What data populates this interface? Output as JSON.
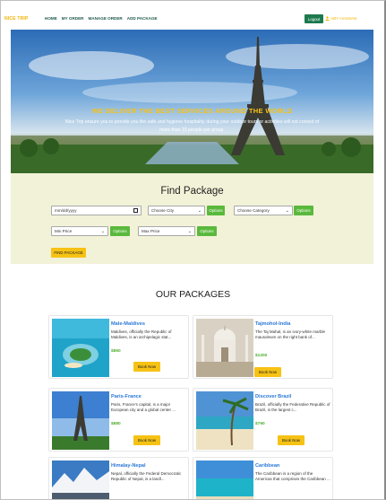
{
  "nav": {
    "brand": "NICE TRIP",
    "links": [
      "HOME",
      "MY ORDER",
      "MANAGE ORDER",
      "ADD PACKAGE"
    ],
    "logout_label": "Logout",
    "user_name": "ABY HASSAN"
  },
  "hero": {
    "title": "WE DELIVER THE BEST SERVICES AROUND THE WORLD",
    "subtitle": "Nice Trip ensure you to provide you the safe and hygiene hospitality during your outdoor tours or activities will not consist of more than 15 people per group."
  },
  "find": {
    "title": "Find Package",
    "date_placeholder": "mm/dd/yyyy",
    "city_select": "Choose City",
    "category_select": "Choose Category",
    "min_price_select": "Min Price",
    "max_price_select": "Max Price",
    "options_label": "Options",
    "find_button": "FIND PACKAGE"
  },
  "packages": {
    "title": "OUR PACKAGES",
    "book_label": "Book Now",
    "items": [
      {
        "title": "Male-Maldives",
        "desc": "Maldives, officially the Republic of Maldives, is an archipelagic stat...",
        "price": "$860",
        "image": "maldives-island-image"
      },
      {
        "title": "Tajmohol-India",
        "desc": "The Taj Mahal, is an ivory-white marble mausoleum on the right bank of...",
        "price": "$1200",
        "image": "taj-mahal-image"
      },
      {
        "title": "Paris-France",
        "desc": "Paris, France's capital, is a major European city and a global center ...",
        "price": "$880",
        "image": "eiffel-tower-image"
      },
      {
        "title": "Discover Brazil",
        "desc": "Brazil, officially the Federative Republic of Brazil, is the largest c...",
        "price": "$790",
        "image": "beach-palm-image"
      },
      {
        "title": "Himalay-Nepal",
        "desc": "Nepal, officially the Federal Democratic Republic of Nepal, is a landl...",
        "price": "",
        "image": "himalaya-image"
      },
      {
        "title": "Caribbean",
        "desc": "The Caribbean is a region of the Americas that comprises the Caribbean ...",
        "price": "",
        "image": "caribbean-image"
      }
    ]
  },
  "colors": {
    "brand_yellow": "#f6c214",
    "nav_green": "#1f5a4b",
    "logout_green": "#1e7a4e",
    "option_green": "#5ab93c",
    "title_blue": "#2a78d6",
    "price_green": "#4caf2e",
    "find_bg": "#f2f2d8"
  }
}
